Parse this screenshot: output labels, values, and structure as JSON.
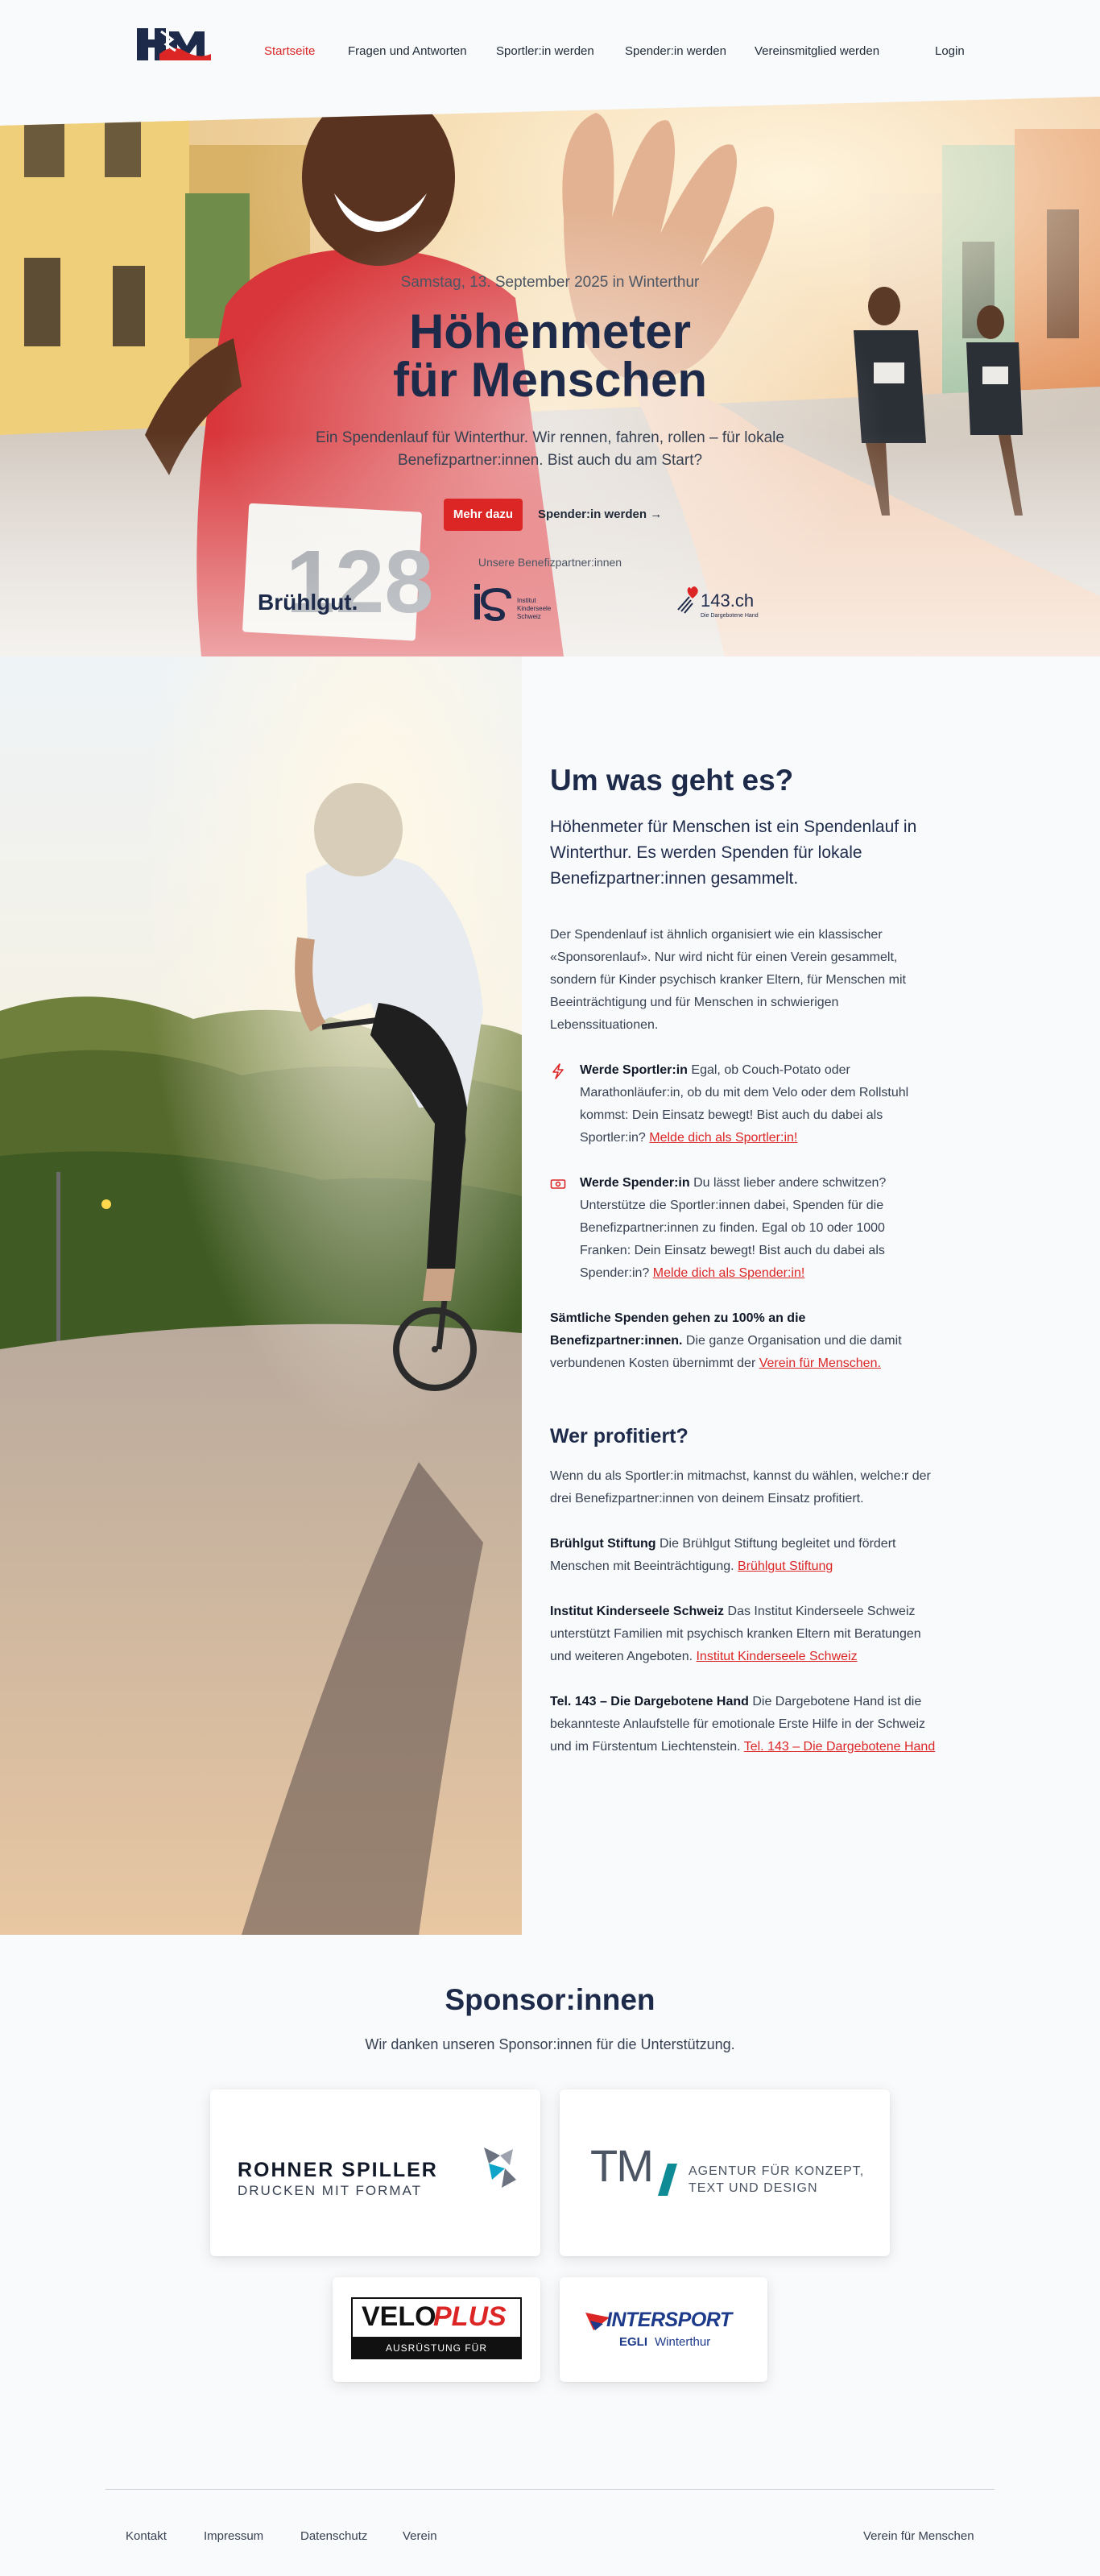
{
  "header": {
    "logo_text": "HfM",
    "nav": [
      {
        "label": "Startseite",
        "active": true
      },
      {
        "label": "Fragen und Antworten"
      },
      {
        "label": "Sportler:in werden"
      },
      {
        "label": "Spender:in werden"
      },
      {
        "label": "Vereinsmitglied werden"
      }
    ],
    "login": "Login"
  },
  "hero": {
    "date": "Samstag, 13. September 2025 in Winterthur",
    "title_line1": "Höhenmeter",
    "title_line2": "für Menschen",
    "subtitle": "Ein Spendenlauf für Winterthur. Wir rennen, fahren, rollen – für lokale Benefizpartner:innen. Bist auch du am Start?",
    "cta_primary": "Mehr dazu",
    "cta_secondary": "Spender:in werden →",
    "partners_label": "Unsere Benefizpartner:innen",
    "partners": [
      {
        "name": "Brühlgut."
      },
      {
        "name": "is",
        "sub": "Institut Kinderseele Schweiz"
      },
      {
        "name": "143.ch",
        "sub": "Die Dargebotene Hand"
      }
    ],
    "bib_number": "128"
  },
  "about": {
    "title": "Um was geht es?",
    "lead": "Höhenmeter für Menschen ist ein Spendenlauf in Winterthur. Es werden Spenden für lokale Benefizpartner:innen gesammelt.",
    "intro": "Der Spendenlauf ist ähnlich organisiert wie ein klassischer «Sponsorenlauf». Nur wird nicht für einen Verein gesammelt, sondern für Kinder psychisch kranker Eltern, für Menschen mit Beeinträchtigung und für Menschen in schwierigen Lebenssituationen.",
    "feature_sportler": {
      "bold": "Werde Sportler:in",
      "text": " Egal, ob Couch-Potato oder Marathonläufer:in, ob du mit dem Velo oder dem Rollstuhl kommst: Dein Einsatz bewegt! Bist auch du dabei als Sportler:in? ",
      "link": "Melde dich als Sportler:in!",
      "icon": "lightning-icon"
    },
    "feature_spender": {
      "bold": "Werde Spender:in",
      "text": " Du lässt lieber andere schwitzen? Unterstütze die Sportler:innen dabei, Spenden für die Benefizpartner:innen zu finden. Egal ob 10 oder 1000 Franken: Dein Einsatz bewegt! Bist auch du dabei als Spender:in? ",
      "link": "Melde dich als Spender:in!",
      "icon": "banknote-icon"
    },
    "donation_note": {
      "bold": "Sämtliche Spenden gehen zu 100% an die Benefizpartner:innen.",
      "text": " Die ganze Organisation und die damit verbundenen Kosten übernimmt der ",
      "link": "Verein für Menschen."
    },
    "profit_title": "Wer profitiert?",
    "profit_intro": "Wenn du als Sportler:in mitmachst, kannst du wählen, welche:r der drei Benefizpartner:innen von deinem Einsatz profitiert.",
    "beneficiaries": [
      {
        "bold": "Brühlgut Stiftung",
        "text": " Die Brühlgut Stiftung begleitet und fördert Menschen mit Beeinträchtigung. ",
        "link": "Brühlgut Stiftung"
      },
      {
        "bold": "Institut Kinderseele Schweiz",
        "text": " Das Institut Kinderseele Schweiz unterstützt Familien mit psychisch kranken Eltern mit Beratungen und weiteren Angeboten. ",
        "link": "Institut Kinderseele Schweiz"
      },
      {
        "bold": "Tel. 143 – Die Dargebotene Hand",
        "text": " Die Dargebotene Hand ist die bekannteste Anlaufstelle für emotionale Erste Hilfe in der Schweiz und im Fürstentum Liechtenstein. ",
        "link": "Tel. 143 – Die Dargebotene Hand"
      }
    ]
  },
  "sponsors": {
    "title": "Sponsor:innen",
    "subtitle": "Wir danken unseren Sponsor:innen für die Unterstützung.",
    "items": [
      {
        "name": "ROHNER SPILLER",
        "tagline": "DRUCKEN MIT FORMAT"
      },
      {
        "name": "TM",
        "tagline_line1": "AGENTUR FÜR KONZEPT,",
        "tagline_line2": "TEXT UND DESIGN"
      },
      {
        "name_part1": "VELO",
        "name_part2": "PLUS",
        "tagline": "AUSRÜSTUNG FÜR ABENTEUER"
      },
      {
        "name": "INTERSPORT",
        "tagline_part1": "EGLI",
        "tagline_part2": "Winterthur"
      }
    ]
  },
  "footer": {
    "links": [
      "Kontakt",
      "Impressum",
      "Datenschutz",
      "Verein"
    ],
    "right": "Verein für Menschen"
  },
  "colors": {
    "accent": "#dc2626",
    "navy": "#1e2a4a",
    "background": "#f8fafc"
  }
}
